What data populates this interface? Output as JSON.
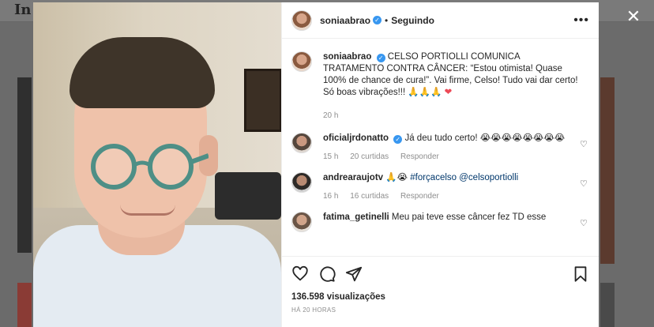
{
  "background": {
    "logo_text": "In",
    "close_icon": "close-icon"
  },
  "post": {
    "username": "soniaabrao",
    "follow_status": "Seguindo",
    "caption_username": "soniaabrao",
    "caption": "CELSO PORTIOLLI COMUNICA TRATAMENTO CONTRA CÂNCER: “Estou otimista! Quase 100% de chance de cura!”. Vai firme, Celso! Tudo vai dar certo! Só boas vibrações!!! 🙏🙏🙏",
    "caption_time": "20 h",
    "views": "136.598 visualizações",
    "posted_ago": "HÁ 20 HORAS",
    "accent_color": "#3897f0"
  },
  "comments": [
    {
      "username": "oficialjrdonatto",
      "verified": true,
      "text": "Já deu tudo certo! 😭😭😭😭😭😭😭😭",
      "time": "15 h",
      "likes": "20 curtidas",
      "reply": "Responder"
    },
    {
      "username": "andrearaujotv",
      "verified": false,
      "text_prefix": "🙏😭",
      "hashtag": "#forçacelso",
      "mention": "@celsoportiolli",
      "time": "16 h",
      "likes": "16 curtidas",
      "reply": "Responder"
    },
    {
      "username": "fatima_getinelli",
      "verified": false,
      "text": "Meu pai teve esse câncer fez TD esse"
    }
  ]
}
